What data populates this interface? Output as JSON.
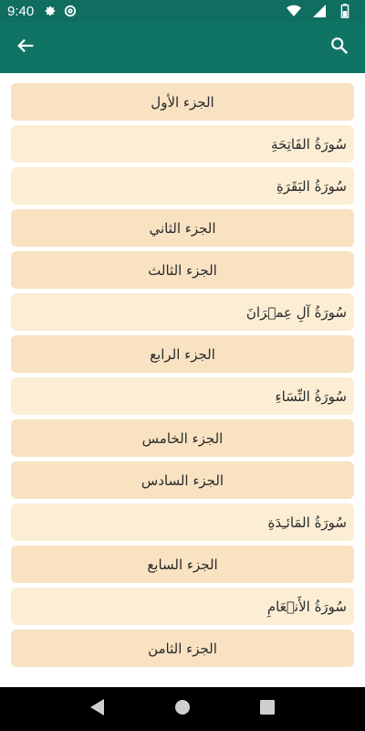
{
  "status_bar": {
    "time": "9:40",
    "icons": [
      "settings-icon",
      "at-sign-icon",
      "wifi-icon",
      "signal-icon",
      "battery-icon"
    ]
  },
  "app_bar": {
    "back_icon": "arrow-left-icon",
    "search_icon": "search-icon",
    "color": "#0f7463"
  },
  "colors": {
    "juz_bg": "#f8e2c2",
    "surah_bg": "#fbeed4",
    "status_bar": "#0f6e60"
  },
  "list": {
    "items": [
      {
        "type": "juz",
        "label": "الجزء الأول"
      },
      {
        "type": "surah",
        "label": "سُورَةُ الفَاتِحَةِ"
      },
      {
        "type": "surah",
        "label": "سُورَةُ البَقَرَةِ"
      },
      {
        "type": "juz",
        "label": "الجزء الثاني"
      },
      {
        "type": "juz",
        "label": "الجزء الثالث"
      },
      {
        "type": "surah",
        "label": "سُورَةُ آلِ عِمۡرَانَ"
      },
      {
        "type": "juz",
        "label": "الجزء الرابع"
      },
      {
        "type": "surah",
        "label": "سُورَةُ النِّسَاءِ"
      },
      {
        "type": "juz",
        "label": "الجزء الخامس"
      },
      {
        "type": "juz",
        "label": "الجزء السادس"
      },
      {
        "type": "surah",
        "label": "سُورَةُ المَائـِدَةِ"
      },
      {
        "type": "juz",
        "label": "الجزء السابع"
      },
      {
        "type": "surah",
        "label": "سُورَةُ الأَنۡعَامِ"
      },
      {
        "type": "juz",
        "label": "الجزء الثامن"
      }
    ]
  },
  "nav_bar": {
    "icons": [
      "back-triangle-icon",
      "home-circle-icon",
      "recents-square-icon"
    ]
  }
}
